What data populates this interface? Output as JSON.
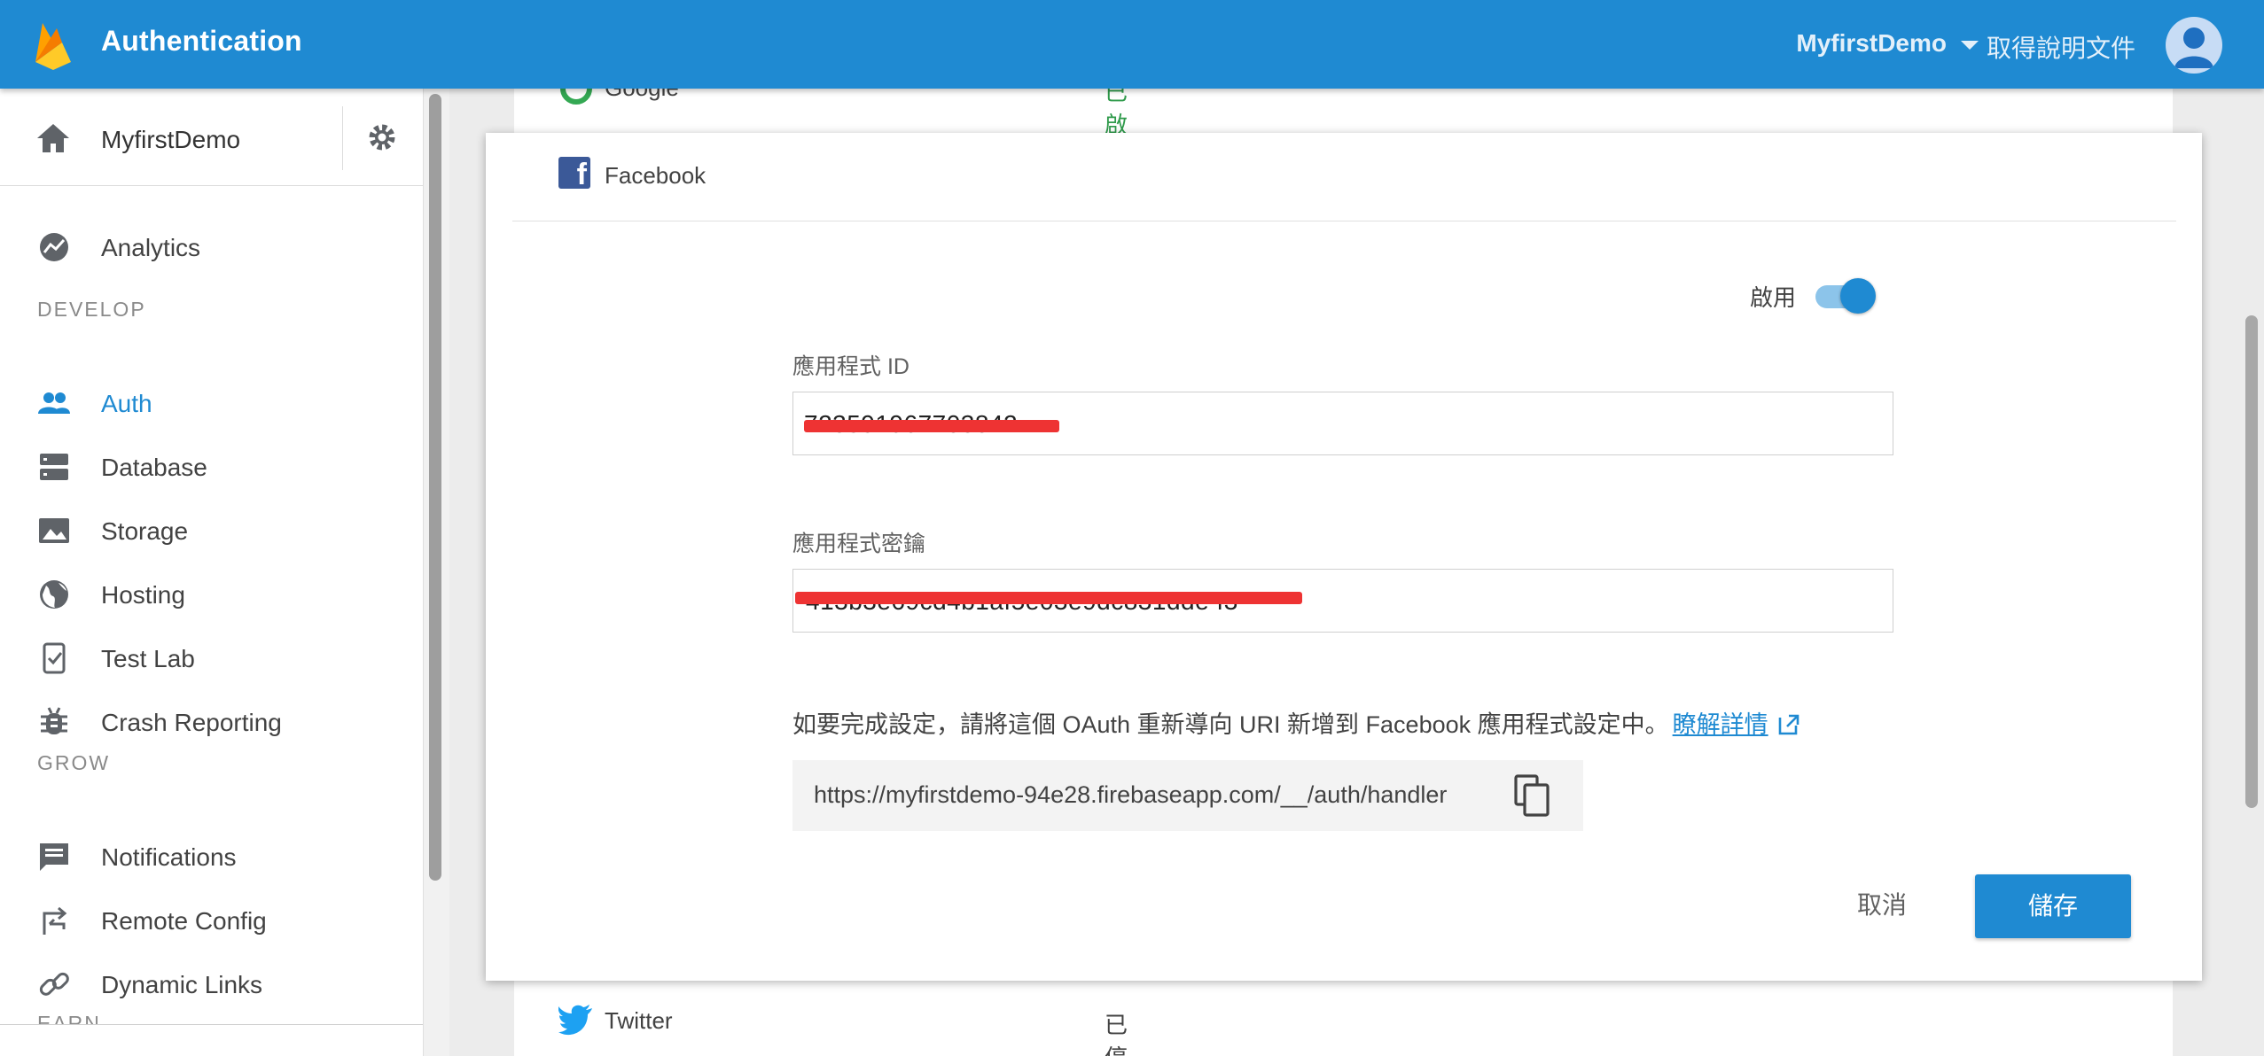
{
  "header": {
    "title": "Authentication",
    "project_name": "MyfirstDemo",
    "docs_label": "取得說明文件"
  },
  "sidebar": {
    "project_name": "MyfirstDemo",
    "nav_top": [
      {
        "label": "Analytics",
        "icon": "analytics-icon"
      }
    ],
    "develop_header": "DEVELOP",
    "develop": [
      {
        "label": "Auth",
        "icon": "people-icon",
        "active": true
      },
      {
        "label": "Database",
        "icon": "database-icon"
      },
      {
        "label": "Storage",
        "icon": "image-icon"
      },
      {
        "label": "Hosting",
        "icon": "globe-icon"
      },
      {
        "label": "Test Lab",
        "icon": "device-check-icon"
      },
      {
        "label": "Crash Reporting",
        "icon": "bug-icon"
      }
    ],
    "grow_header": "GROW",
    "grow": [
      {
        "label": "Notifications",
        "icon": "message-icon"
      },
      {
        "label": "Remote Config",
        "icon": "swap-icon"
      },
      {
        "label": "Dynamic Links",
        "icon": "link-icon"
      }
    ],
    "earn_header": "EARN"
  },
  "providers": {
    "google": {
      "name": "Google",
      "status": "已啟用"
    },
    "facebook": {
      "name": "Facebook"
    },
    "twitter": {
      "name": "Twitter",
      "status": "已停用"
    }
  },
  "facebook_config": {
    "enable_label": "啟用",
    "enabled": true,
    "app_id_label": "應用程式 ID",
    "app_id_value": "723591967703842",
    "app_secret_label": "應用程式密鑰",
    "app_secret_value": "413b3e69cd4b1af5e03e9dc831dde f3",
    "hint_text": "如要完成設定，請將這個 OAuth 重新導向 URI 新增到 Facebook 應用程式設定中。",
    "learn_more": "瞭解詳情",
    "redirect_uri": "https://myfirstdemo-94e28.firebaseapp.com/__/auth/handler",
    "cancel_label": "取消",
    "save_label": "儲存"
  },
  "colors": {
    "topbar": "#1f8ad2",
    "accent": "#1f8ad2",
    "redaction": "#ee3333"
  }
}
